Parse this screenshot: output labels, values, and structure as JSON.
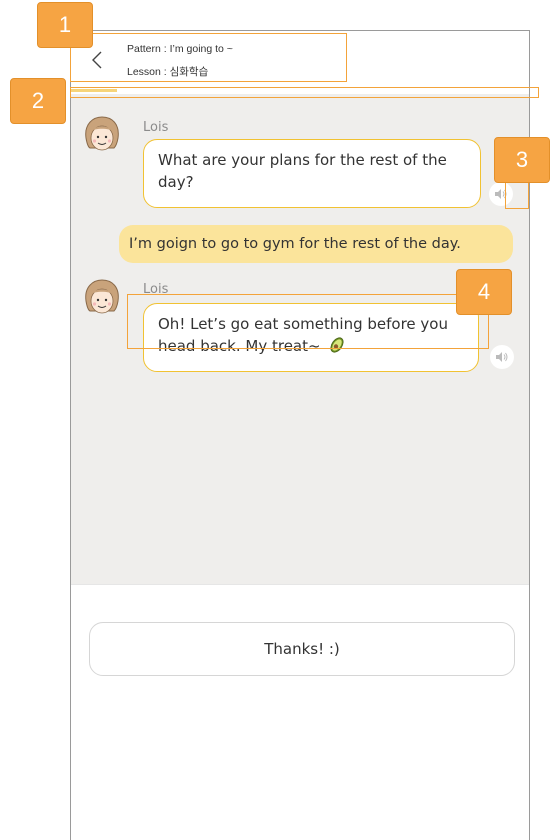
{
  "header": {
    "pattern_text": "Pattern : I’m going to ~",
    "lesson_text": "Lesson : 심화학습"
  },
  "progress": {
    "value": 0.1
  },
  "messages": [
    {
      "speaker": "Lois",
      "text": "What are your plans for the rest of the day?"
    },
    {
      "text": "I’m goign to go to gym for the rest of the day."
    },
    {
      "speaker": "Lois",
      "text": "Oh! Let’s go eat something before you head back. My treat~"
    }
  ],
  "answer": {
    "label": "Thanks! :)"
  },
  "annotations": [
    "1",
    "2",
    "3",
    "4"
  ],
  "colors": {
    "accent": "#f1c232",
    "user_bubble": "#fbe49b",
    "chat_bg": "#efeeec",
    "annotation": "#f6a443"
  },
  "icons": [
    "back-chevron-icon",
    "speaker-icon",
    "avocado-emoji-icon",
    "lois-avatar"
  ]
}
